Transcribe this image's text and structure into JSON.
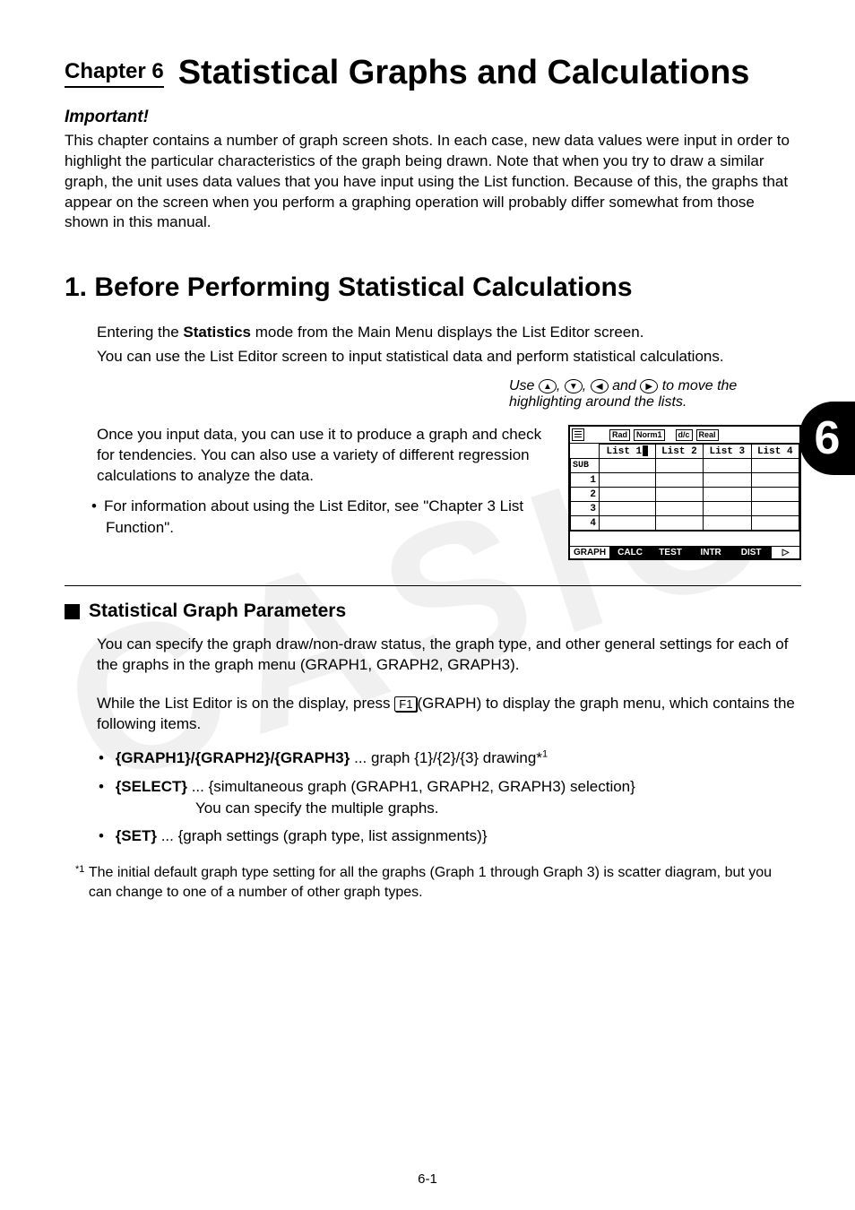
{
  "watermark": "CASIO",
  "chapter": {
    "label": "Chapter 6",
    "title": "Statistical Graphs and Calculations"
  },
  "important": {
    "heading": "Important!",
    "body": "This chapter contains a number of graph screen shots. In each case, new data values were input in order to highlight the particular characteristics of the graph being drawn. Note that when you try to draw a similar graph, the unit uses data values that you have input using the List function. Because of this, the graphs that appear on the screen when you perform a graphing operation will probably differ somewhat from those shown in this manual."
  },
  "section1": {
    "heading": "1. Before Performing Statistical Calculations",
    "p1a": "Entering the ",
    "p1b": "Statistics",
    "p1c": " mode from the Main Menu displays the List Editor screen.",
    "p2": "You can use the List Editor screen to input statistical data and perform statistical calculations.",
    "nav_a": "Use ",
    "nav_b": " to move the highlighting around the lists.",
    "nav_keys": {
      "up": "▲",
      "down": "▼",
      "left": "◀",
      "right": "▶"
    },
    "nav_sep1": ", ",
    "nav_sep2": ", ",
    "nav_sep3": " and ",
    "p3": "Once you input data, you can use it to produce a graph and check for tendencies. You can also use a variety of different regression calculations to analyze the data.",
    "bullet": "For information about using the List Editor, see \"Chapter 3 List Function\"."
  },
  "calc": {
    "badges": [
      "Rad",
      "Norm1",
      "d/c",
      "Real"
    ],
    "headers": [
      "SUB",
      "List 1",
      "List 2",
      "List 3",
      "List 4"
    ],
    "rows": [
      "1",
      "2",
      "3",
      "4"
    ],
    "softkeys": [
      "GRAPH",
      "CALC",
      "TEST",
      "INTR",
      "DIST"
    ],
    "softkey_arrow": "▷"
  },
  "side_tab": "6",
  "section2": {
    "heading": "Statistical Graph Parameters",
    "p1": "You can specify the graph draw/non-draw status, the graph type, and other general settings for each of the graphs in the graph menu (GRAPH1, GRAPH2, GRAPH3).",
    "p2a": "While the List Editor is on the display, press ",
    "p2_key": "F1",
    "p2b": "(GRAPH) to display the graph menu, which contains the following items.",
    "items": {
      "g_label": "{GRAPH1}/{GRAPH2}/{GRAPH3}",
      "g_desc": " ... graph {1}/{2}/{3} drawing*",
      "g_sup": "1",
      "sel_label": "{SELECT}",
      "sel_desc": " ... {simultaneous graph (GRAPH1, GRAPH2, GRAPH3) selection}",
      "sel_sub": "You can specify the multiple graphs.",
      "set_label": "{SET}",
      "set_desc": " ... {graph settings (graph type, list assignments)}"
    },
    "footnote_mark": "*1",
    "footnote": " The initial default graph type setting for all the graphs (Graph 1 through Graph 3) is scatter diagram, but you can change to one of a number of other graph types."
  },
  "page_number": "6-1"
}
